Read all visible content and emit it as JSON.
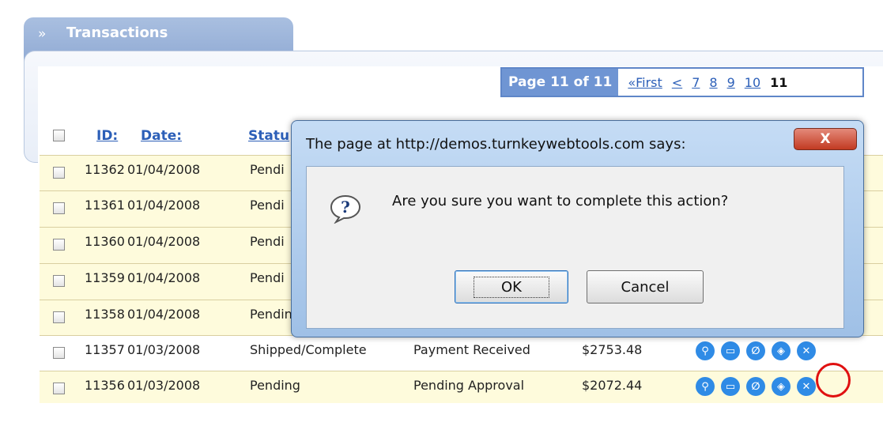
{
  "panel": {
    "title": "Transactions"
  },
  "pager": {
    "label": "Page 11 of 11",
    "first": "«First",
    "prev": "<",
    "pages": [
      "7",
      "8",
      "9",
      "10"
    ],
    "current": "11"
  },
  "table": {
    "headers": {
      "id": "ID:",
      "date": "Date:",
      "status": "Statu"
    },
    "rows": [
      {
        "id": "11362",
        "date": "01/04/2008",
        "status": "Pendi",
        "payment": "",
        "amount": ""
      },
      {
        "id": "11361",
        "date": "01/04/2008",
        "status": "Pendi",
        "payment": "",
        "amount": ""
      },
      {
        "id": "11360",
        "date": "01/04/2008",
        "status": "Pendi",
        "payment": "",
        "amount": ""
      },
      {
        "id": "11359",
        "date": "01/04/2008",
        "status": "Pendi",
        "payment": "",
        "amount": ""
      },
      {
        "id": "11358",
        "date": "01/04/2008",
        "status": "Pending",
        "payment": "",
        "amount": ""
      },
      {
        "id": "11357",
        "date": "01/03/2008",
        "status": "Shipped/Complete",
        "payment": "Payment Received",
        "amount": "$2753.48"
      },
      {
        "id": "11356",
        "date": "01/03/2008",
        "status": "Pending",
        "payment": "Pending Approval",
        "amount": "$2072.44"
      }
    ],
    "actions": [
      "search-icon",
      "print-icon",
      "attach-icon",
      "tag-icon",
      "cancel-icon"
    ]
  },
  "dialog": {
    "title": "The page at http://demos.turnkeywebtools.com says:",
    "close": "X",
    "message": "Are you sure you want to complete this action?",
    "ok": "OK",
    "cancel": "Cancel"
  },
  "colors": {
    "accent": "#6f95d3",
    "highlight": "#e01010",
    "row_alt": "#fefbdc",
    "action": "#2f8be6"
  }
}
